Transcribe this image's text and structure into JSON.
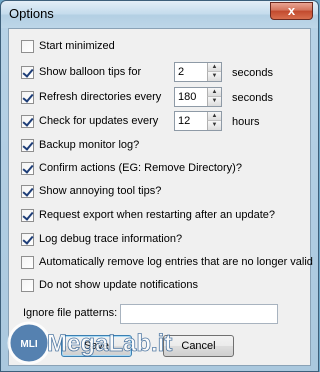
{
  "window": {
    "title": "Options",
    "close_glyph": "x"
  },
  "options": [
    {
      "label": "Start minimized",
      "checked": false
    },
    {
      "label": "Show balloon tips for",
      "checked": true
    },
    {
      "label": "Refresh directories every",
      "checked": true
    },
    {
      "label": "Check for updates every",
      "checked": true
    },
    {
      "label": "Backup monitor log?",
      "checked": true
    },
    {
      "label": "Confirm actions (EG: Remove Directory)?",
      "checked": true
    },
    {
      "label": "Show annoying tool tips?",
      "checked": true
    },
    {
      "label": "Request export when restarting after an update?",
      "checked": true
    },
    {
      "label": "Log debug trace information?",
      "checked": true
    },
    {
      "label": "Automatically remove log entries that are no longer valid",
      "checked": false
    },
    {
      "label": "Do not show update notifications",
      "checked": false
    }
  ],
  "spinners": {
    "balloon": {
      "value": "2",
      "unit": "seconds"
    },
    "refresh": {
      "value": "180",
      "unit": "seconds"
    },
    "updates": {
      "value": "12",
      "unit": "hours"
    }
  },
  "ignore": {
    "label": "Ignore file patterns:",
    "value": ""
  },
  "buttons": {
    "save": "Save",
    "cancel": "Cancel"
  },
  "watermark": {
    "text": "MegaLab.it",
    "badge": "MLI"
  },
  "colors": {
    "accent": "#3c7fb1",
    "close": "#c24a2e"
  }
}
